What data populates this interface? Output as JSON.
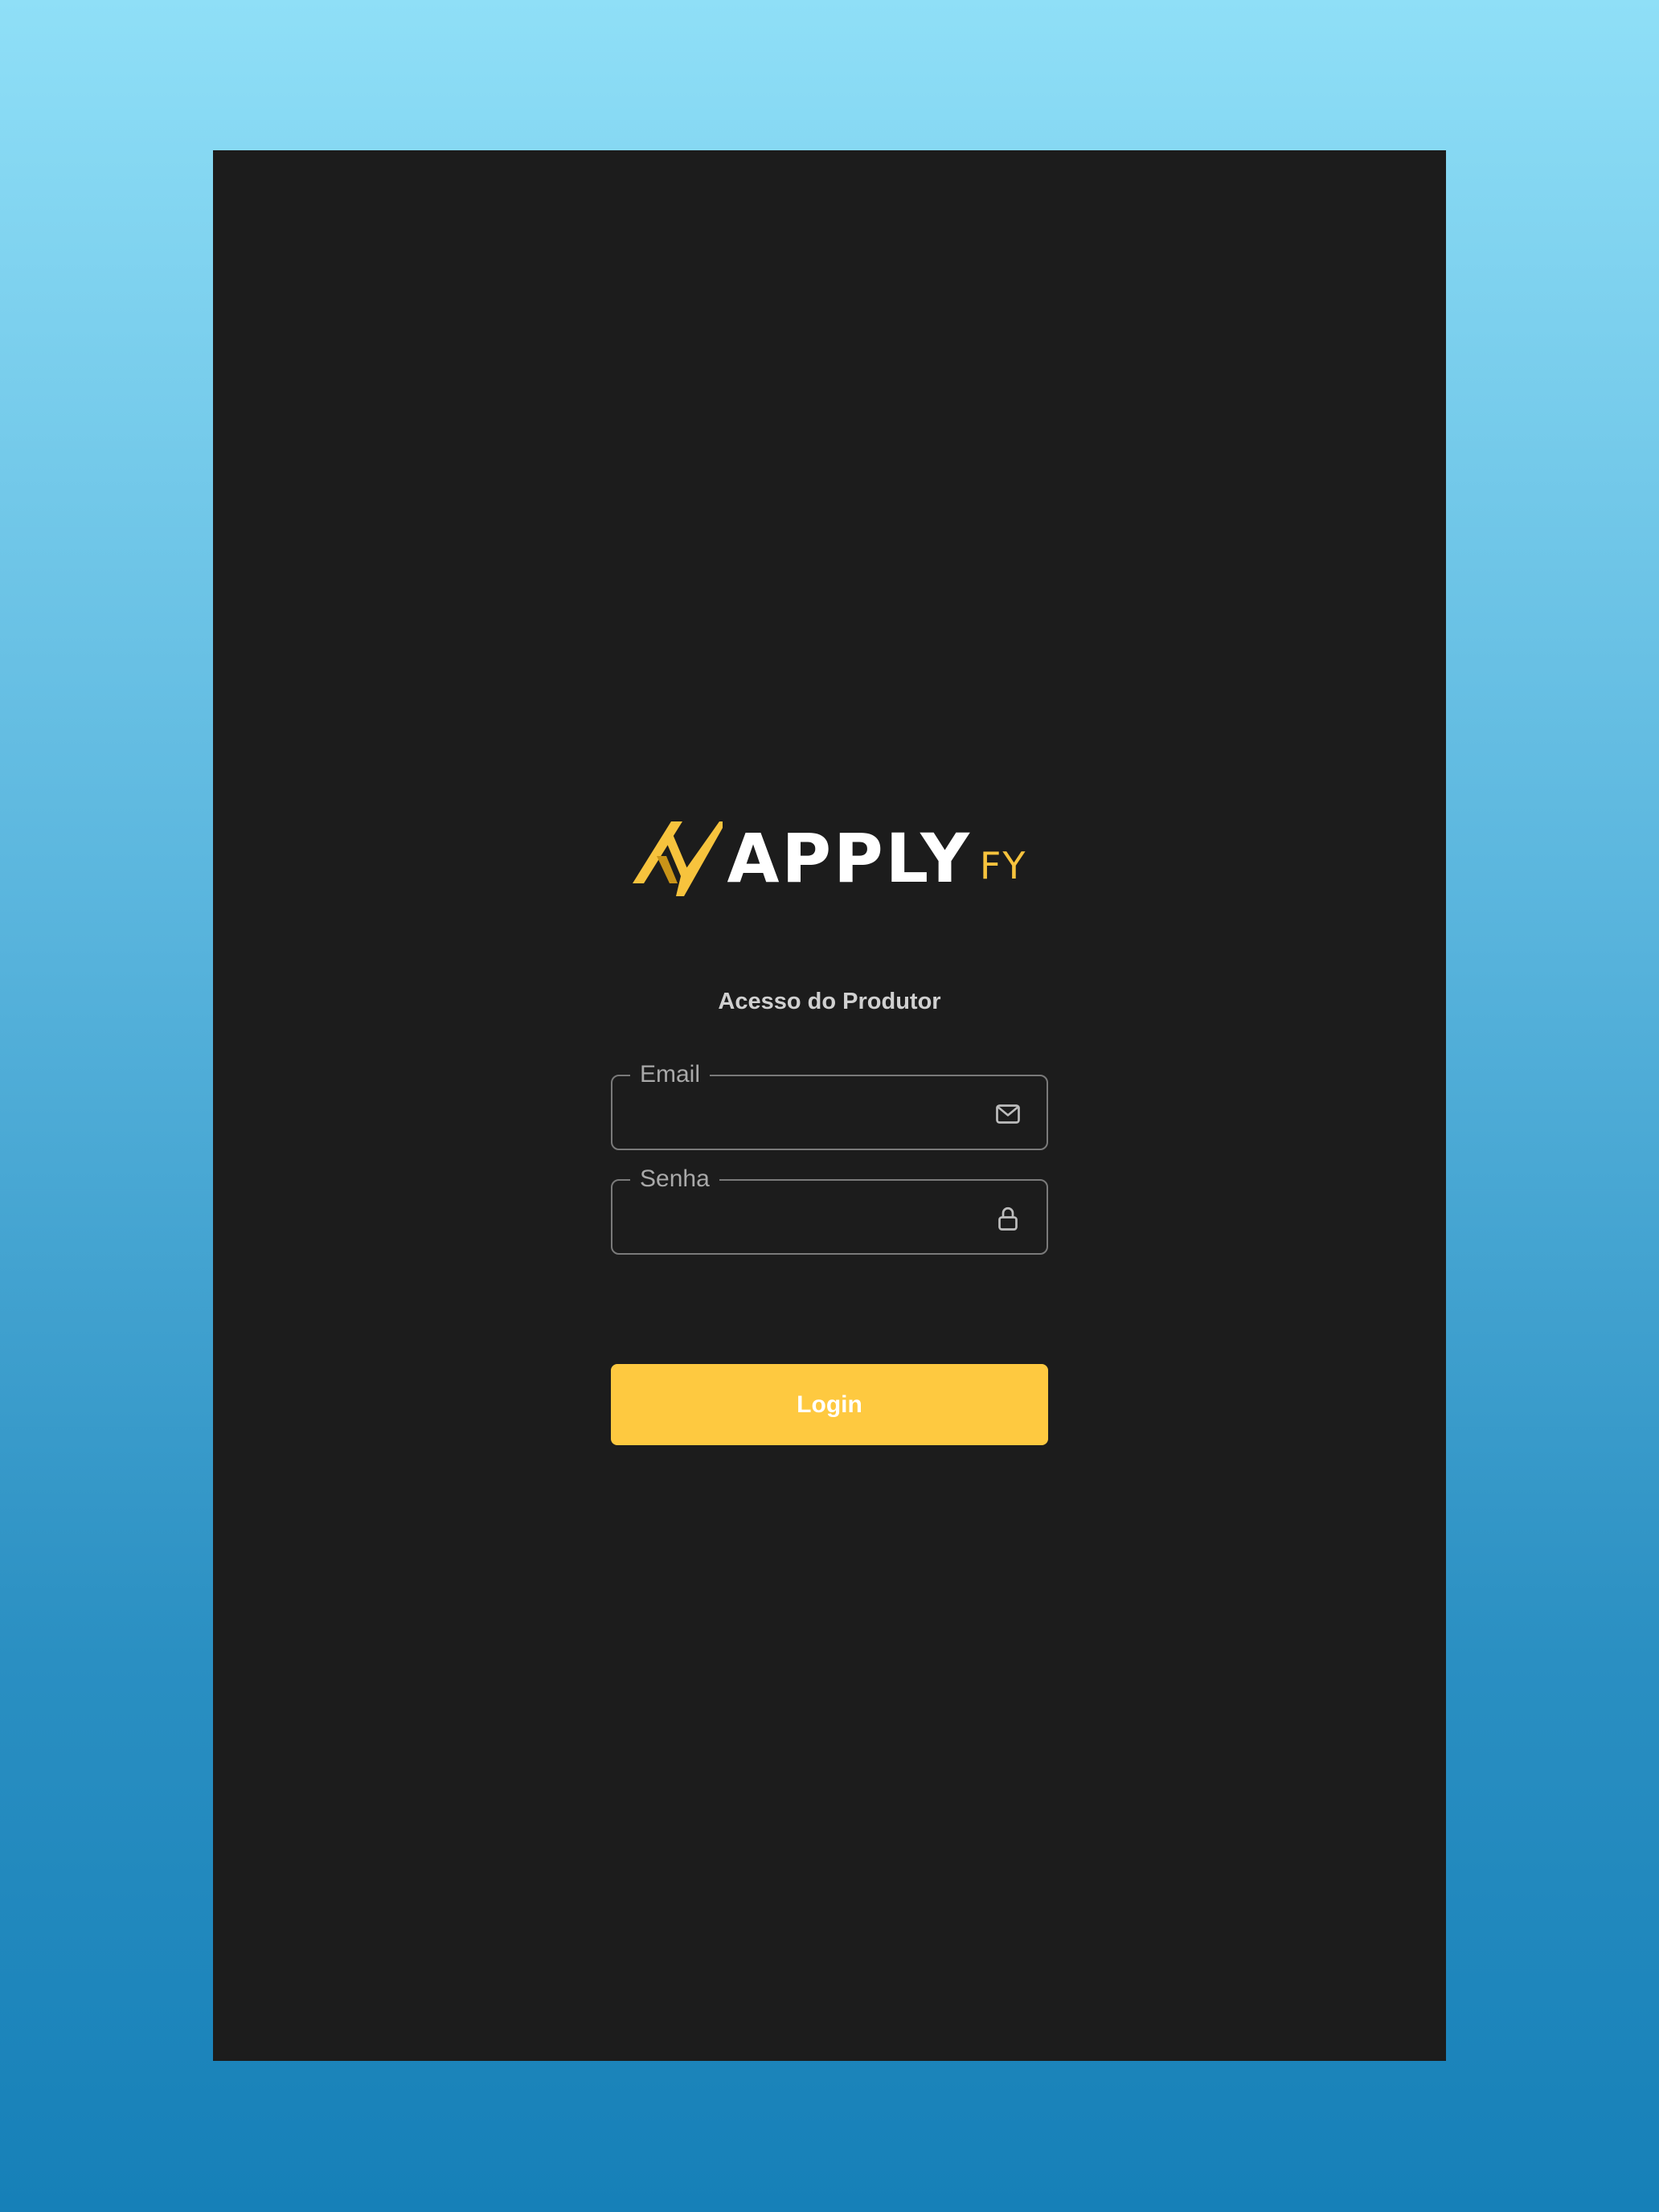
{
  "brand": {
    "name": "APPLY",
    "suffix": "FY",
    "accent_color": "#fec940",
    "logo_icon": "lightning-n-logo-icon"
  },
  "login": {
    "title": "Acesso do Produtor",
    "email": {
      "label": "Email",
      "value": "",
      "icon": "mail-icon"
    },
    "password": {
      "label": "Senha",
      "value": "",
      "icon": "lock-icon"
    },
    "submit_label": "Login"
  },
  "colors": {
    "page_background": "#1c1c1c",
    "field_border": "#7a7a7a",
    "button_background": "#fec940",
    "button_text": "#ffffff"
  }
}
